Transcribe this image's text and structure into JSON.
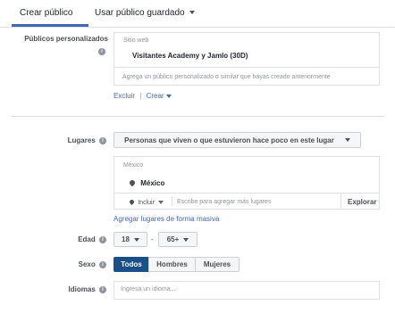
{
  "tabs": [
    {
      "label": "Crear público"
    },
    {
      "label": "Usar público guardado"
    }
  ],
  "custom_audiences": {
    "label": "Públicos personalizados",
    "source_type": "Sitio web",
    "audience_name": "Visitantes Academy y Jamlo (30D)",
    "placeholder": "Agrega un público personalizado o similar que hayas creado anteriormente",
    "exclude_label": "Excluir",
    "separator": "|",
    "create_label": "Crear"
  },
  "locations": {
    "label": "Lugares",
    "dropdown": "Personas que viven o que estuvieron hace poco en este lugar",
    "country_header": "México",
    "selected": "México",
    "include_label": "Incluir",
    "placeholder": "Escribe para agregar más lugares",
    "explore_label": "Explorar",
    "bulk_link": "Agregar lugares de forma masiva"
  },
  "age": {
    "label": "Edad",
    "min": "18",
    "separator": "-",
    "max": "65+"
  },
  "gender": {
    "label": "Sexo",
    "options": [
      "Todos",
      "Hombres",
      "Mujeres"
    ]
  },
  "languages": {
    "label": "Idiomas",
    "placeholder": "Ingresa un idioma..."
  },
  "info_glyph": "i"
}
